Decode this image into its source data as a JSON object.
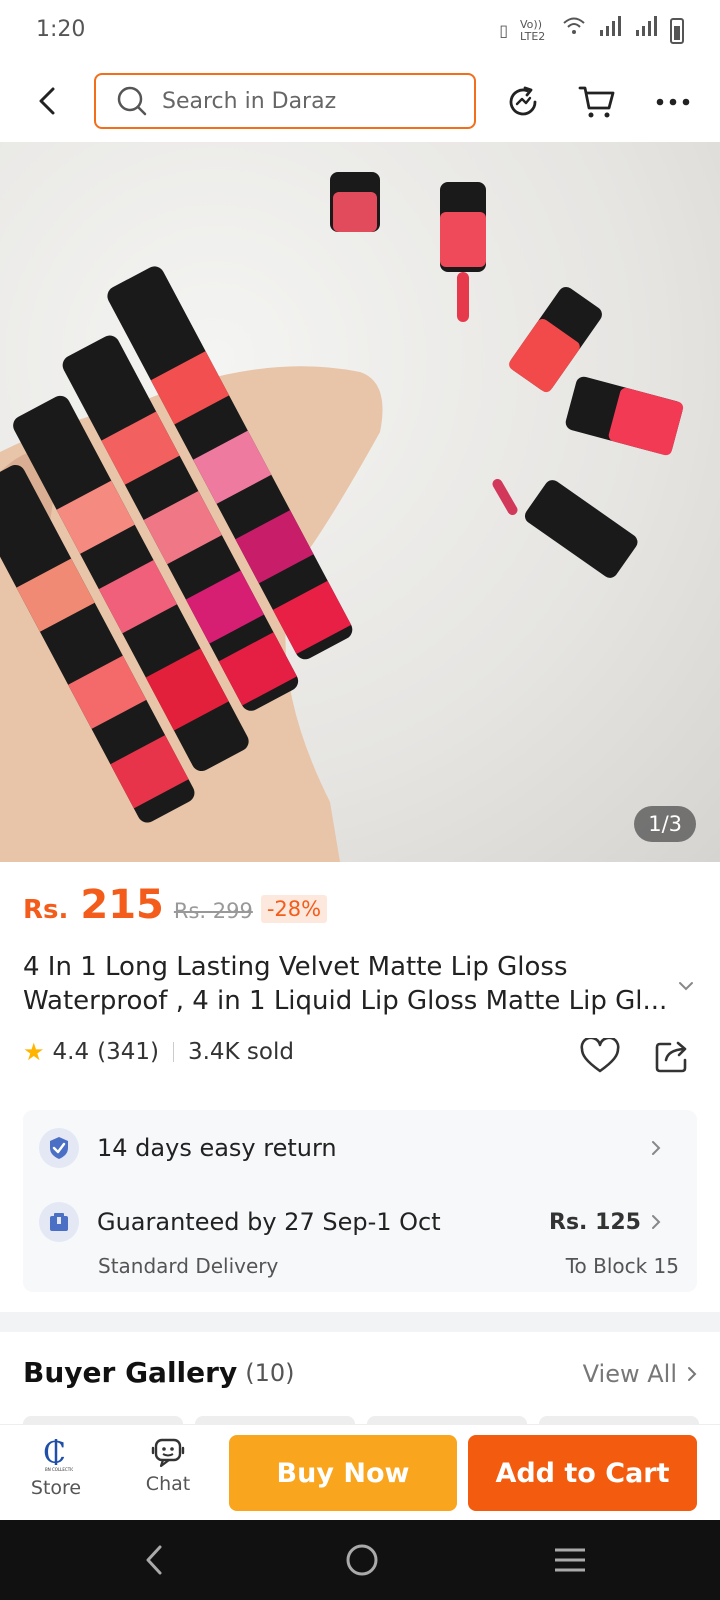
{
  "status": {
    "time": "1:20",
    "volte": "Vo)) LTE2"
  },
  "search": {
    "placeholder": "Search in Daraz"
  },
  "image": {
    "counter": "1/3"
  },
  "price": {
    "currency": "Rs.",
    "current": "215",
    "original": "Rs. 299",
    "discount": "-28%"
  },
  "title": {
    "line1": "4 In 1 Long Lasting Velvet Matte Lip Gloss",
    "line2": "Waterproof , 4 in 1 Liquid Lip Gloss Matte Lip Gl..."
  },
  "rating": {
    "score": "4.4",
    "count": "(341)",
    "sold": "3.4K sold"
  },
  "service": {
    "return": "14 days easy return",
    "delivery": "Guaranteed by 27 Sep-1 Oct",
    "delivery_type": "Standard Delivery",
    "fee": "Rs. 125",
    "location": "To Block 15"
  },
  "gallery": {
    "title": "Buyer Gallery",
    "count": "(10)",
    "view_all": "View All"
  },
  "actions": {
    "store": "Store",
    "chat": "Chat",
    "buy_now": "Buy Now",
    "add_to_cart": "Add to Cart"
  },
  "colors": {
    "brand": "#f35b0e",
    "buy_now": "#faa51e",
    "search_border": "#f26e1b"
  },
  "icons": [
    "back-icon",
    "search-icon",
    "refresh-icon",
    "cart-icon",
    "more-icon",
    "heart-icon",
    "share-icon",
    "shield-icon",
    "delivery-icon",
    "store-icon",
    "chat-icon"
  ]
}
